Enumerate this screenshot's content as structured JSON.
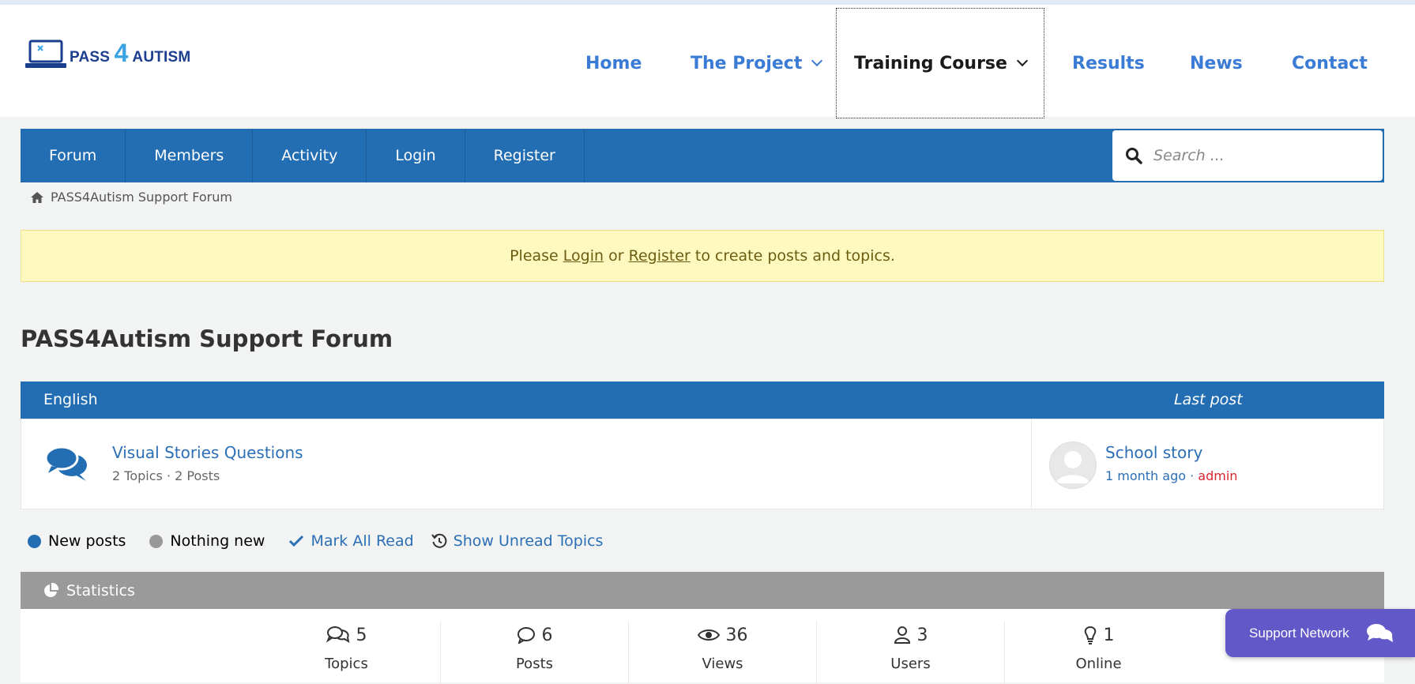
{
  "site": {
    "logo": {
      "part1": "PASS",
      "part2": "4",
      "part3": "AUTISM"
    },
    "nav": [
      {
        "label": "Home",
        "has_dropdown": false,
        "active": false
      },
      {
        "label": "The Project",
        "has_dropdown": true,
        "active": false
      },
      {
        "label": "Training Course",
        "has_dropdown": true,
        "active": true
      },
      {
        "label": "Results",
        "has_dropdown": false,
        "active": false
      },
      {
        "label": "News",
        "has_dropdown": false,
        "active": false
      },
      {
        "label": "Contact",
        "has_dropdown": false,
        "active": false
      }
    ]
  },
  "forum_nav": {
    "items": [
      "Forum",
      "Members",
      "Activity",
      "Login",
      "Register"
    ],
    "search_placeholder": "Search ..."
  },
  "breadcrumb": {
    "label": "PASS4Autism Support Forum"
  },
  "notice": {
    "before": "Please",
    "login": "Login",
    "or": "or",
    "register": "Register",
    "after": "to create posts and topics."
  },
  "page_title": "PASS4Autism Support Forum",
  "category": {
    "title": "English",
    "last_post_header": "Last post",
    "forums": [
      {
        "name": "Visual Stories Questions",
        "meta": "2 Topics · 2 Posts",
        "last_post": {
          "title": "School story",
          "time": "1 month ago",
          "sep": " · ",
          "user": "admin"
        }
      }
    ]
  },
  "legend": {
    "new_posts": "New posts",
    "nothing_new": "Nothing new",
    "mark_all_read": "Mark All Read",
    "show_unread": "Show Unread Topics"
  },
  "statistics": {
    "title": "Statistics",
    "items": [
      {
        "value": "5",
        "label": "Topics",
        "icon": "topics-icon"
      },
      {
        "value": "6",
        "label": "Posts",
        "icon": "posts-icon"
      },
      {
        "value": "36",
        "label": "Views",
        "icon": "eye-icon"
      },
      {
        "value": "3",
        "label": "Users",
        "icon": "user-icon"
      },
      {
        "value": "1",
        "label": "Online",
        "icon": "lightbulb-icon"
      }
    ]
  },
  "support_button": {
    "label": "Support Network"
  },
  "colors": {
    "brand_blue": "#236db3",
    "link_blue": "#2c6fb6",
    "nav_blue": "#3a7bd5",
    "notice_bg": "#fef9be",
    "stats_header": "#9a9a9a",
    "support_purple": "#6258c8",
    "admin_red": "#d8262f"
  }
}
